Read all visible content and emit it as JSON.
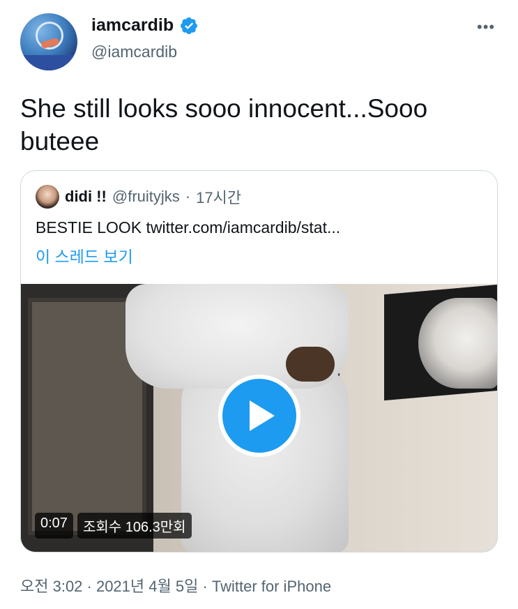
{
  "author": {
    "display_name": "iamcardib",
    "handle": "@iamcardib",
    "verified": true,
    "verified_icon": "verified-badge-icon",
    "more_label": "•••"
  },
  "tweet": {
    "text": "She still looks sooo innocent...Sooo buteee"
  },
  "quoted": {
    "name": "didi !!",
    "handle": "@fruityjks",
    "separator": "·",
    "time": "17시간",
    "text": "BESTIE LOOK  twitter.com/iamcardib/stat...",
    "thread_link": "이 스레드 보기"
  },
  "video": {
    "duration": "0:07",
    "views": "조회수 106.3만회",
    "play_icon": "play-icon"
  },
  "footer": {
    "meta": "오전 3:02 · 2021년 4월 5일 · Twitter for iPhone"
  },
  "colors": {
    "accent": "#1d9bf0",
    "secondary_text": "#536471",
    "border": "#cfd9de"
  }
}
